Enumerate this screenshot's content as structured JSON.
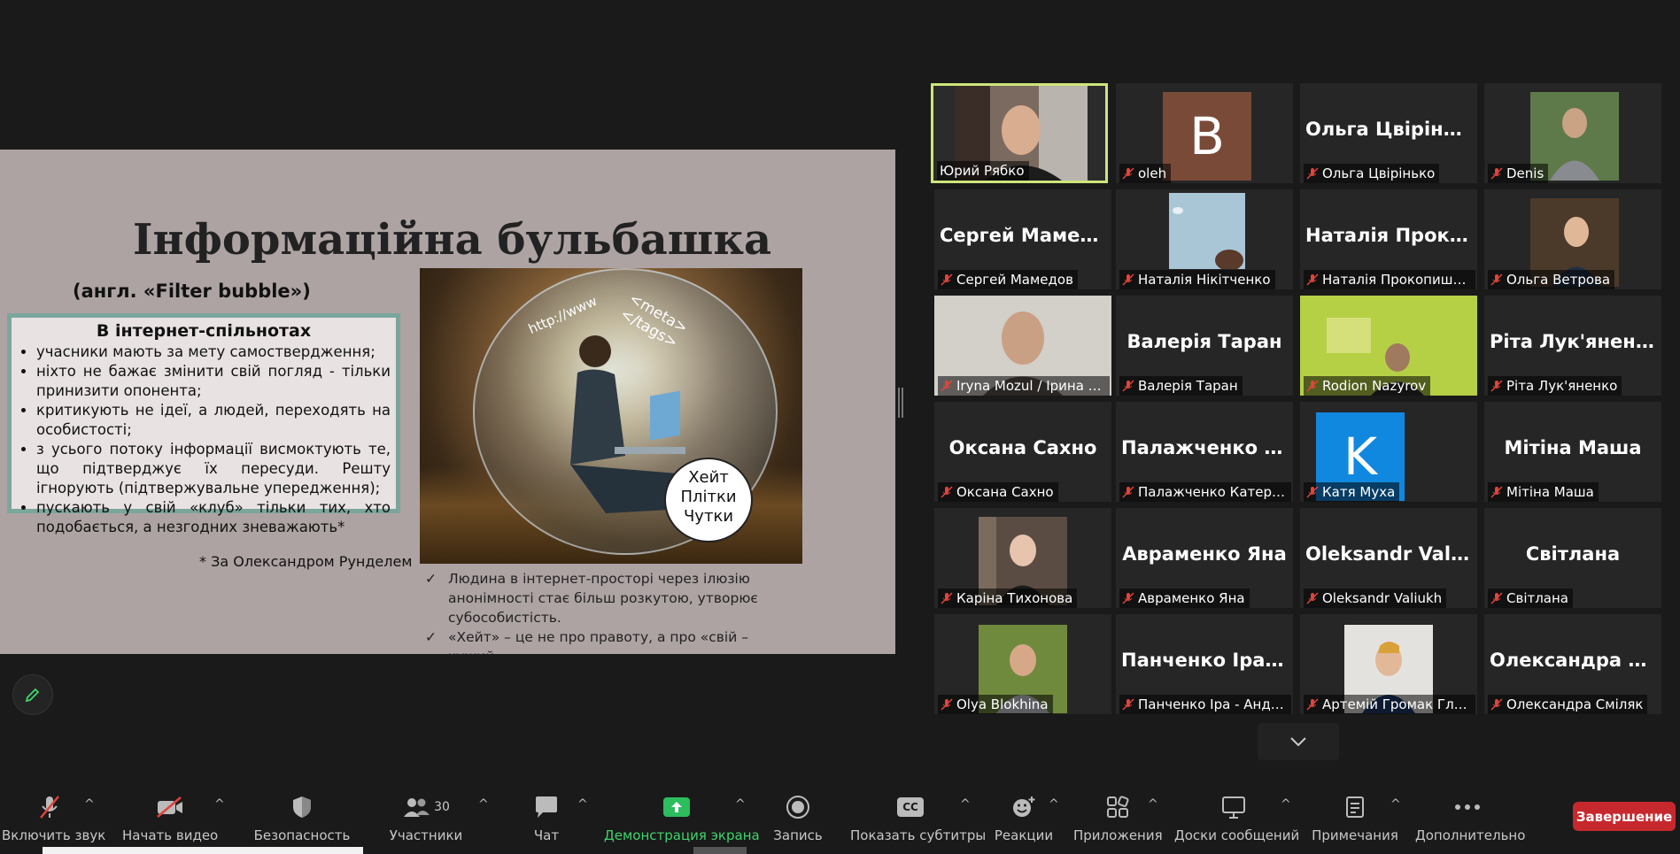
{
  "slide": {
    "title": "Інформаційна бульбашка",
    "subtitle": "(англ. «Filter bubble»)",
    "box_title": "В інтернет-спільнотах",
    "bullets": [
      "учасники мають за мету самоствердження;",
      "ніхто не бажає змінити свій погляд - тільки принизити опонента;",
      "критикують не ідеї, а людей, переходять на особистості;",
      "з усього потоку інформації висмоктують те, що підтверджує їх пересуди. Решту ігнорують (підтвержувальне упередження);",
      "пускають у свій «клуб» тільки тих, хто подобається, а незгодних зневажають*"
    ],
    "footnote": "* За Олександром Рунделем",
    "image_texts": {
      "http": "http://www",
      "meta": "<meta>",
      "tags": "</tags>"
    },
    "speech_lines": [
      "Хейт",
      "Плітки",
      "Чутки"
    ],
    "checks": [
      "Людина в інтернет-просторі через ілюзію анонімності стає більш розкутою, утворює субособистість.",
      "«Хейт» – це не про правоту, а про «свій – чужий»."
    ]
  },
  "participants": [
    {
      "label": "Юрий Рябко",
      "type": "video",
      "muted": false,
      "active": true
    },
    {
      "label": "oleh",
      "type": "letter",
      "letter": "B",
      "letter_bg": "#7a4a38",
      "muted": true
    },
    {
      "label": "Ольга Цвірінько",
      "type": "name",
      "display": "Ольга Цвірінько",
      "muted": true
    },
    {
      "label": "Denis",
      "type": "photo",
      "muted": true
    },
    {
      "label": "Сергей Мамедов",
      "type": "name",
      "display": "Сергей Мамедов",
      "muted": true
    },
    {
      "label": "Наталія Нікітченко",
      "type": "photo",
      "muted": true
    },
    {
      "label": "Наталія Прокопишина",
      "type": "name",
      "display": "Наталія Проко...",
      "muted": true
    },
    {
      "label": "Ольга Ветрова",
      "type": "photo",
      "muted": true
    },
    {
      "label": "Iryna Mozul / Ірина М...",
      "type": "video",
      "muted": true
    },
    {
      "label": "Валерія Таран",
      "type": "name",
      "display": "Валерія Таран",
      "muted": true
    },
    {
      "label": "Rodion Nazyrov",
      "type": "video",
      "muted": true
    },
    {
      "label": "Ріта Лук'яненко",
      "type": "name",
      "display": "Ріта Лук'яненко",
      "muted": true
    },
    {
      "label": "Оксана Сахно",
      "type": "name",
      "display": "Оксана Сахно",
      "muted": true
    },
    {
      "label": "Палажченко Катерина",
      "type": "name",
      "display": "Палажченко К...",
      "muted": true
    },
    {
      "label": "Катя Муха",
      "type": "letter",
      "letter": "K",
      "letter_bg": "#1188e0",
      "muted": true
    },
    {
      "label": "Мітіна Маша",
      "type": "name",
      "display": "Мітіна Маша",
      "muted": true
    },
    {
      "label": "Каріна Тихонова",
      "type": "photo",
      "muted": true
    },
    {
      "label": "Авраменко Яна",
      "type": "name",
      "display": "Авраменко Яна",
      "muted": true
    },
    {
      "label": "Oleksandr Valiukh",
      "type": "name",
      "display": "Oleksandr Valiukh",
      "muted": true
    },
    {
      "label": "Світлана",
      "type": "name",
      "display": "Світлана",
      "muted": true
    },
    {
      "label": "Olya Blokhina",
      "type": "photo",
      "muted": true
    },
    {
      "label": "Панченко Іра - Андрія...",
      "type": "name",
      "display": "Панченко Іра -...",
      "muted": true
    },
    {
      "label": "Артемій Громак Глухі...",
      "type": "photo",
      "muted": true
    },
    {
      "label": "Олександра Сміляк",
      "type": "name",
      "display": "Олександра См...",
      "muted": true
    }
  ],
  "toolbar": {
    "unmute": "Включить звук",
    "start_video": "Начать видео",
    "security": "Безопасность",
    "participants": "Участники",
    "participants_count": "30",
    "chat": "Чат",
    "share": "Демонстрация экрана",
    "record": "Запись",
    "captions": "Показать субтитры",
    "cc": "CC",
    "reactions": "Реакции",
    "apps": "Приложения",
    "whiteboards": "Доски сообщений",
    "notes": "Примечания",
    "more": "Дополнительно",
    "end": "Завершение"
  },
  "colors": {
    "active_border": "#cde57a",
    "share_green": "#3fd46c",
    "end_red": "#c7282e"
  }
}
